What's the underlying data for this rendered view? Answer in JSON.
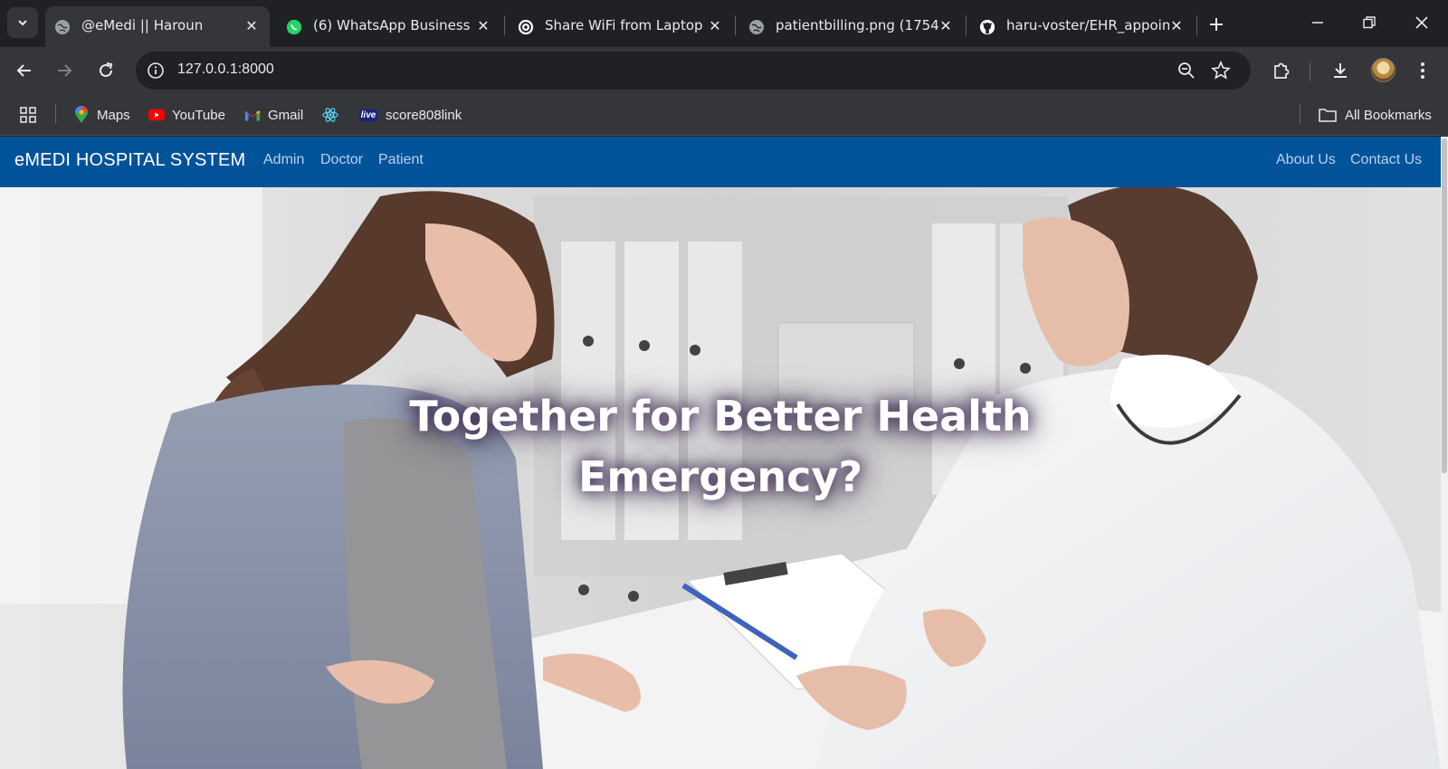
{
  "browser": {
    "tabs": [
      {
        "title": "@eMedi || Haroun",
        "icon": "globe-icon",
        "active": true
      },
      {
        "title": "(6) WhatsApp Business",
        "icon": "whatsapp-icon",
        "active": false
      },
      {
        "title": "Share WiFi from Laptop",
        "icon": "openai-icon",
        "active": false
      },
      {
        "title": "patientbilling.png (1754×",
        "icon": "globe-icon",
        "active": false
      },
      {
        "title": "haru-voster/EHR_appoint",
        "icon": "github-icon",
        "active": false
      }
    ],
    "url": "127.0.0.1:8000",
    "bookmarks": [
      {
        "label": "Maps",
        "icon": "maps-icon"
      },
      {
        "label": "YouTube",
        "icon": "youtube-icon"
      },
      {
        "label": "Gmail",
        "icon": "gmail-icon"
      },
      {
        "label": "",
        "icon": "react-icon"
      },
      {
        "label": "score808link",
        "icon": "live-icon",
        "icon_text": "live"
      }
    ],
    "all_bookmarks": "All Bookmarks",
    "colors": {
      "frame": "#202124",
      "toolbar": "#35363a"
    }
  },
  "site": {
    "brand": "eMEDI HOSPITAL SYSTEM",
    "nav_left": [
      "Admin",
      "Doctor",
      "Patient"
    ],
    "nav_right": [
      "About Us",
      "Contact Us"
    ],
    "hero_line1": "Together for Better Health",
    "hero_line2": "Emergency?",
    "colors": {
      "navbar": "#03539a",
      "navlink": "#b8d2ef"
    }
  }
}
